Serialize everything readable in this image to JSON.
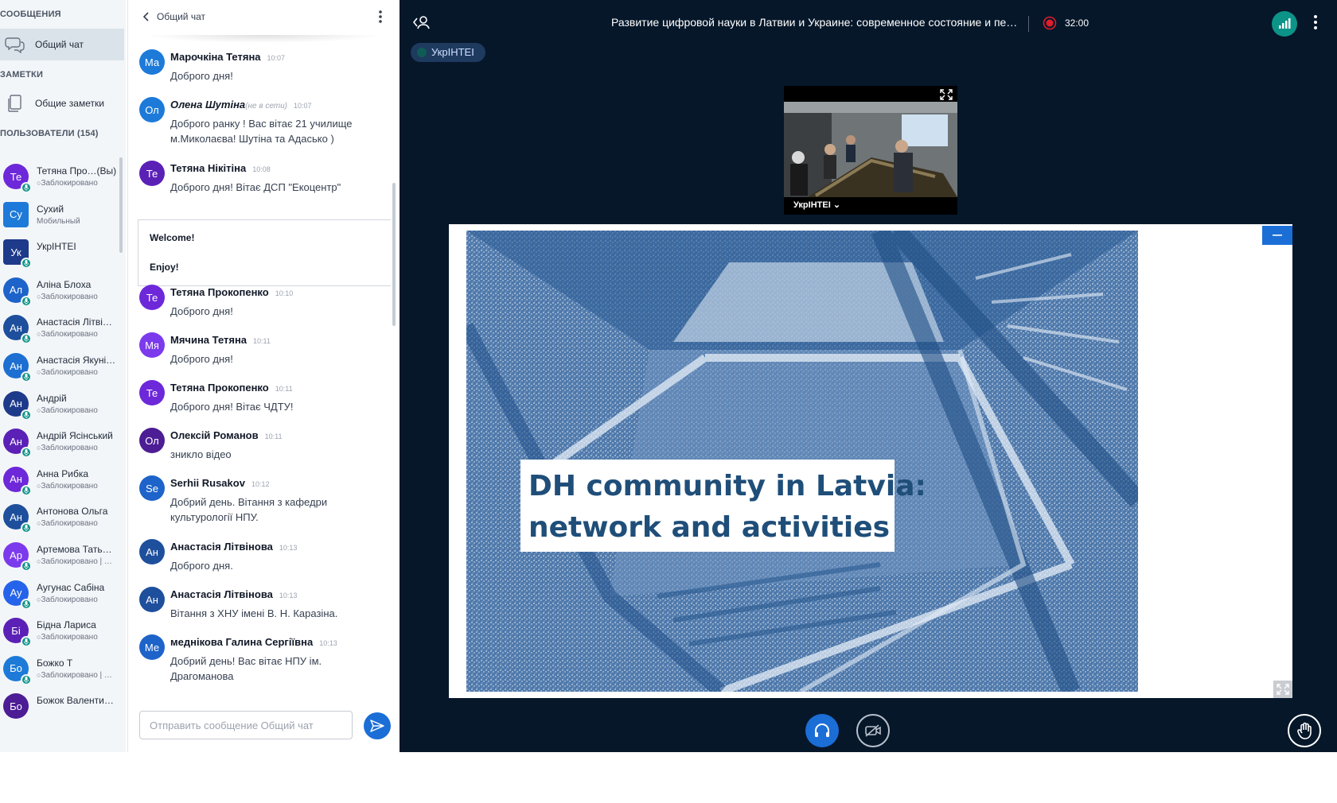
{
  "sidebar": {
    "messages_title": "СООБЩЕНИЯ",
    "public_chat_label": "Общий чат",
    "notes_title": "ЗАМЕТКИ",
    "shared_notes_label": "Общие заметки",
    "users_title": "ПОЛЬЗОВАТЕЛИ (154)",
    "users": [
      {
        "initials": "Те",
        "name": "Тетяна Про…(Вы)",
        "status": "Заблокировано",
        "color": "#6d28d9",
        "square": false,
        "badge": true
      },
      {
        "initials": "Су",
        "name": "Сухий",
        "status": "Мобильный",
        "color": "#1d7ad9",
        "square": true,
        "badge": false
      },
      {
        "initials": "Ук",
        "name": "УкрІНТЕІ",
        "status": "",
        "color": "#1e3a8a",
        "square": true,
        "badge": true
      },
      {
        "initials": "Ал",
        "name": "Аліна Блоха",
        "status": "Заблокировано",
        "color": "#1d63c9",
        "square": false,
        "badge": true
      },
      {
        "initials": "Ан",
        "name": "Анастасія Літві…",
        "status": "Заблокировано",
        "color": "#1e4f9c",
        "square": false,
        "badge": true
      },
      {
        "initials": "Ан",
        "name": "Анастасія Якуні…",
        "status": "Заблокировано",
        "color": "#1d6fd1",
        "square": false,
        "badge": true
      },
      {
        "initials": "Ан",
        "name": "Андрій",
        "status": "Заблокировано",
        "color": "#1e3a8a",
        "square": false,
        "badge": true
      },
      {
        "initials": "Ан",
        "name": "Андрій Ясінський",
        "status": "Заблокировано",
        "color": "#5b21b6",
        "square": false,
        "badge": true
      },
      {
        "initials": "Ан",
        "name": "Анна Рибка",
        "status": "Заблокировано",
        "color": "#6d28d9",
        "square": false,
        "badge": true
      },
      {
        "initials": "Ан",
        "name": "Антонова Ольга",
        "status": "Заблокировано",
        "color": "#1e4f9c",
        "square": false,
        "badge": true
      },
      {
        "initials": "Ар",
        "name": "Артемова Тать…",
        "status": "Заблокировано | …",
        "color": "#7c3aed",
        "square": false,
        "badge": true
      },
      {
        "initials": "Ау",
        "name": "Аугунас Сабіна",
        "status": "Заблокировано",
        "color": "#2563eb",
        "square": false,
        "badge": true
      },
      {
        "initials": "Бі",
        "name": "Бідна Лариса",
        "status": "Заблокировано",
        "color": "#5b21b6",
        "square": false,
        "badge": true
      },
      {
        "initials": "Бо",
        "name": "Божко Т",
        "status": "Заблокировано | …",
        "color": "#1d7ad9",
        "square": false,
        "badge": true
      },
      {
        "initials": "Бо",
        "name": "Божок Валенти…",
        "status": "",
        "color": "#4c1d95",
        "square": false,
        "badge": false
      }
    ]
  },
  "chat": {
    "title": "Общий чат",
    "welcome_line1": "Welcome!",
    "welcome_line2": "Enjoy!",
    "input_placeholder": "Отправить сообщение Общий чат",
    "messages": [
      {
        "initials": "Ма",
        "name": "Марочкіна Тетяна",
        "offline": "",
        "time": "10:07",
        "text": "Доброго дня!",
        "color": "#1d7ad9",
        "italic": false
      },
      {
        "initials": "Ол",
        "name": "Олена Шутіна",
        "offline": "(не в сети)",
        "time": "10:07",
        "text": "Доброго ранку ! Вас вітає 21 училище м.Миколаєва! Шутіна та Адасько )",
        "color": "#1d7ad9",
        "italic": true
      },
      {
        "initials": "Те",
        "name": "Тетяна Нікітіна",
        "offline": "",
        "time": "10:08",
        "text": "Доброго дня! Вітає ДСП \"Екоцентр\"",
        "color": "#5b21b6",
        "italic": false
      },
      {
        "initials": "Те",
        "name": "Тетяна Прокопенко",
        "offline": "",
        "time": "10:10",
        "text": "Доброго дня!",
        "color": "#6d28d9",
        "italic": false
      },
      {
        "initials": "Мя",
        "name": "Мячина Тетяна",
        "offline": "",
        "time": "10:11",
        "text": "Доброго дня!",
        "color": "#7c3aed",
        "italic": false
      },
      {
        "initials": "Те",
        "name": "Тетяна Прокопенко",
        "offline": "",
        "time": "10:11",
        "text": "Доброго дня! Вітає ЧДТУ!",
        "color": "#6d28d9",
        "italic": false
      },
      {
        "initials": "Ол",
        "name": "Олексій Романов",
        "offline": "",
        "time": "10:11",
        "text": "зникло відео",
        "color": "#4c1d95",
        "italic": false
      },
      {
        "initials": "Se",
        "name": "Serhii Rusakov",
        "offline": "",
        "time": "10:12",
        "text": "Добрий день. Вітання з кафедри культурології НПУ.",
        "color": "#1d63c9",
        "italic": false
      },
      {
        "initials": "Ан",
        "name": "Анастасія Літвінова",
        "offline": "",
        "time": "10:13",
        "text": "Доброго дня.",
        "color": "#1e4f9c",
        "italic": false
      },
      {
        "initials": "Ан",
        "name": "Анастасія Літвінова",
        "offline": "",
        "time": "10:13",
        "text": "Вітання з ХНУ імені В. Н. Каразіна.",
        "color": "#1e4f9c",
        "italic": false
      },
      {
        "initials": "Ме",
        "name": "меднікова Галина Сергіївна",
        "offline": "",
        "time": "10:13",
        "text": "Добрий день! Вас вітає НПУ ім. Драгоманова",
        "color": "#1d63c9",
        "italic": false
      }
    ]
  },
  "stage": {
    "meeting_title": "Развитие цифровой науки в Латвии и Украине: современное состояние и пе…",
    "record_time": "32:00",
    "speaker": "УкрІНТЕІ",
    "webcam_name": "УкрІНТЕІ ⌄",
    "slide_line1": "DH community in Latvia:",
    "slide_line2": "network and activities"
  },
  "colors": {
    "stage_bg": "#06172a",
    "accent_blue": "#1b6ed6",
    "connection_green": "#0d9488",
    "record_red": "#e11d2a"
  }
}
